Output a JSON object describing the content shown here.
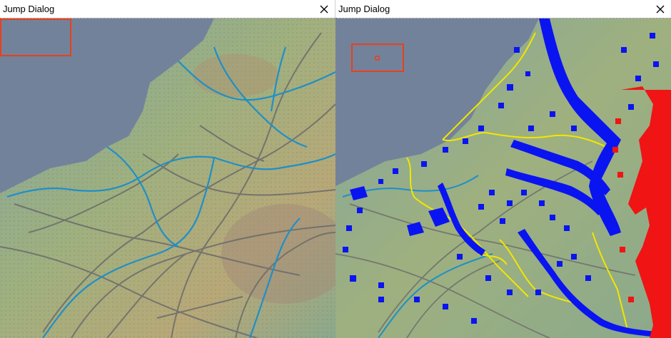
{
  "windows": [
    {
      "title": "Jump Dialog",
      "close_icon": "close-icon",
      "map": {
        "description_key": "terrain-map-base",
        "selection_rect_color": "#e8401c",
        "sea_color": "#73829b",
        "land_colors": [
          "#7fa6a0",
          "#9fb07f",
          "#b8a878",
          "#6fa0b4"
        ],
        "river_color": "#1f8fc8",
        "road_color": "#6b6b6b"
      }
    },
    {
      "title": "Jump Dialog",
      "close_icon": "close-icon",
      "map": {
        "description_key": "terrain-map-units",
        "selection_rect_color": "#e8401c",
        "allied_unit_color": "#0a14f0",
        "enemy_unit_color": "#f01414",
        "border_color": "#f2e600",
        "sea_color": "#73829b"
      }
    }
  ]
}
